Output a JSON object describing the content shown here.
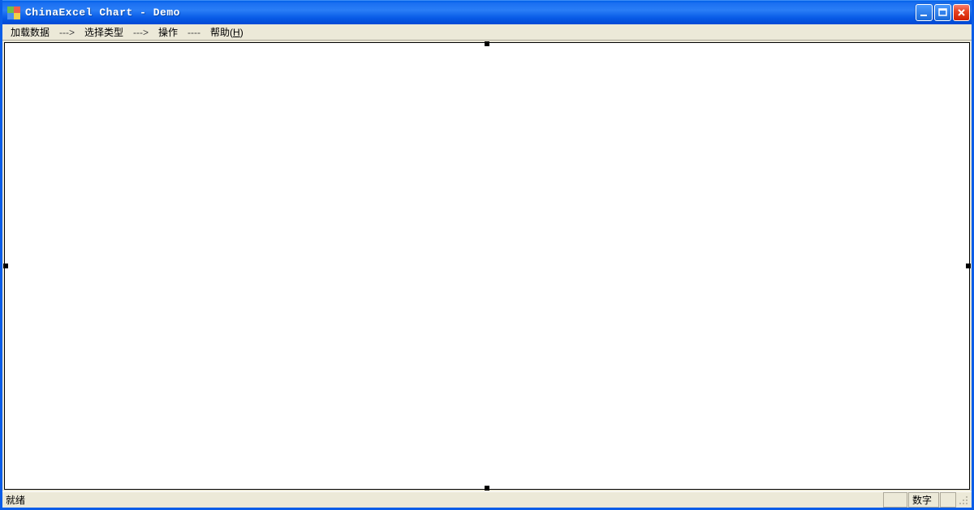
{
  "window": {
    "title": "ChinaExcel Chart - Demo"
  },
  "menu": {
    "items": [
      {
        "label": "加载数据",
        "sep": "--->"
      },
      {
        "label": "选择类型",
        "sep": "--->"
      },
      {
        "label": "操作",
        "sep": "----"
      }
    ],
    "help_prefix": "帮助(",
    "help_key": "H",
    "help_suffix": ")"
  },
  "status": {
    "ready": "就绪",
    "num": "数字"
  }
}
